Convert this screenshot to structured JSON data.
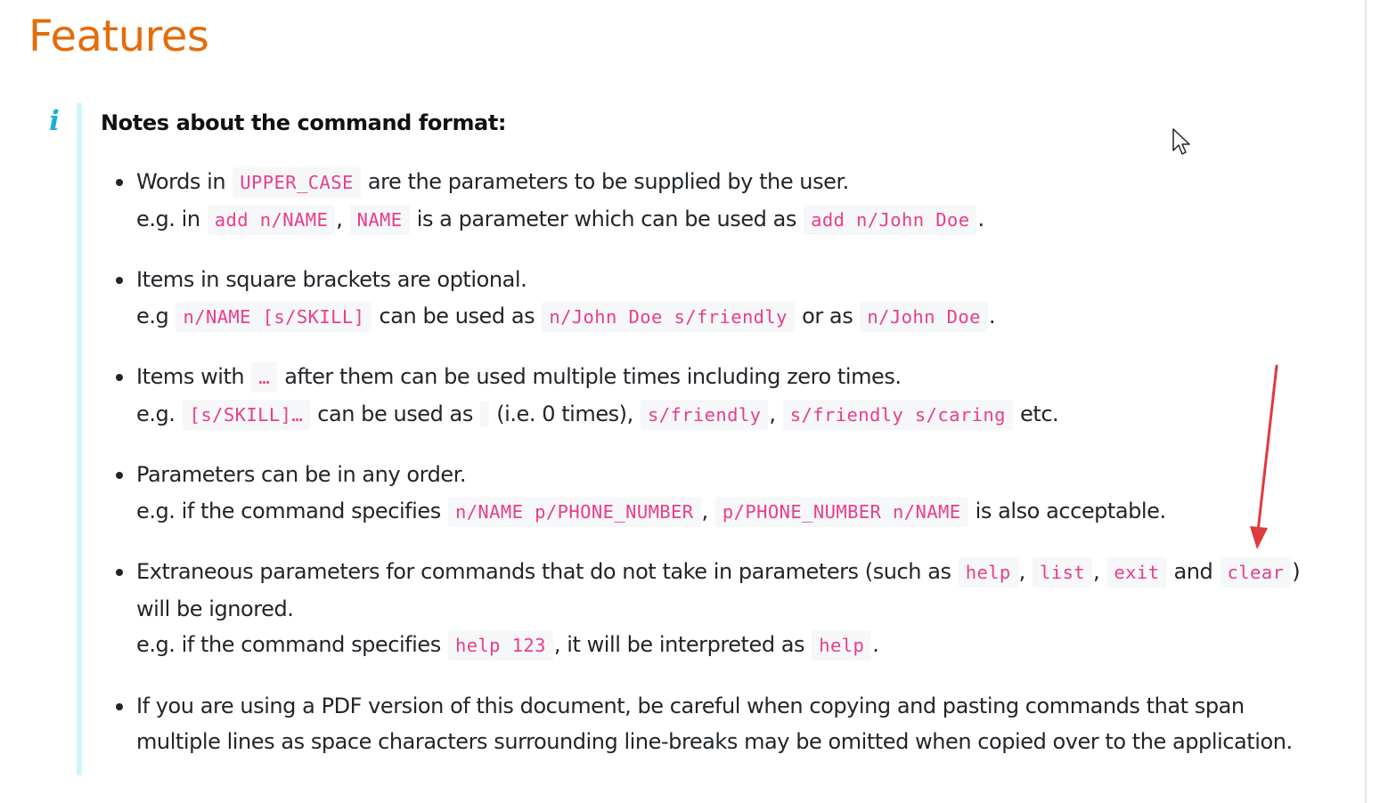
{
  "heading": "Features",
  "callout": {
    "icon": "info-icon",
    "title": "Notes about the command format:",
    "accent_color": "#17b1d6",
    "bar_color": "#d3f3fb"
  },
  "items": [
    {
      "line1": {
        "t1": "Words in ",
        "c1": "UPPER_CASE",
        "t2": " are the parameters to be supplied by the user."
      },
      "line2": {
        "t1": "e.g. in ",
        "c1": "add n/NAME",
        "t2": ", ",
        "c2": "NAME",
        "t3": " is a parameter which can be used as ",
        "c3": "add n/John Doe",
        "t4": "."
      }
    },
    {
      "line1": {
        "t1": "Items in square brackets are optional."
      },
      "line2": {
        "t1": "e.g ",
        "c1": "n/NAME [s/SKILL]",
        "t2": " can be used as ",
        "c2": "n/John Doe s/friendly",
        "t3": " or as ",
        "c3": "n/John Doe",
        "t4": "."
      }
    },
    {
      "line1": {
        "t1": "Items with ",
        "c1": "…",
        "t2": " after them can be used multiple times including zero times."
      },
      "line2": {
        "t1": "e.g. ",
        "c1": "[s/SKILL]…",
        "t2": " can be used as ",
        "t3": " (i.e. 0 times), ",
        "c2": "s/friendly",
        "t4": ", ",
        "c3": "s/friendly s/caring",
        "t5": " etc."
      }
    },
    {
      "line1": {
        "t1": "Parameters can be in any order."
      },
      "line2": {
        "t1": "e.g. if the command specifies ",
        "c1": "n/NAME p/PHONE_NUMBER",
        "t2": ", ",
        "c2": "p/PHONE_NUMBER n/NAME",
        "t3": " is also acceptable."
      }
    },
    {
      "line1": {
        "t1": "Extraneous parameters for commands that do not take in parameters (such as ",
        "c1": "help",
        "t2": ", ",
        "c2": "list",
        "t3": ", ",
        "c3": "exit",
        "t4": " and ",
        "c4": "clear",
        "t5": ")"
      },
      "line1b": "will be ignored.",
      "line2": {
        "t1": "e.g. if the command specifies ",
        "c1": "help 123",
        "t2": ", it will be interpreted as ",
        "c2": "help",
        "t3": "."
      }
    },
    {
      "line1": {
        "t1": "If you are using a PDF version of this document, be careful when copying and pasting commands that span"
      },
      "line1b": "multiple lines as space characters surrounding line-breaks may be omitted when copied over to the application."
    }
  ],
  "colors": {
    "heading": "#e46c0a",
    "code_text": "#e83e8c",
    "code_background": "#f6f7f8",
    "annotation_arrow": "#e0393e"
  }
}
